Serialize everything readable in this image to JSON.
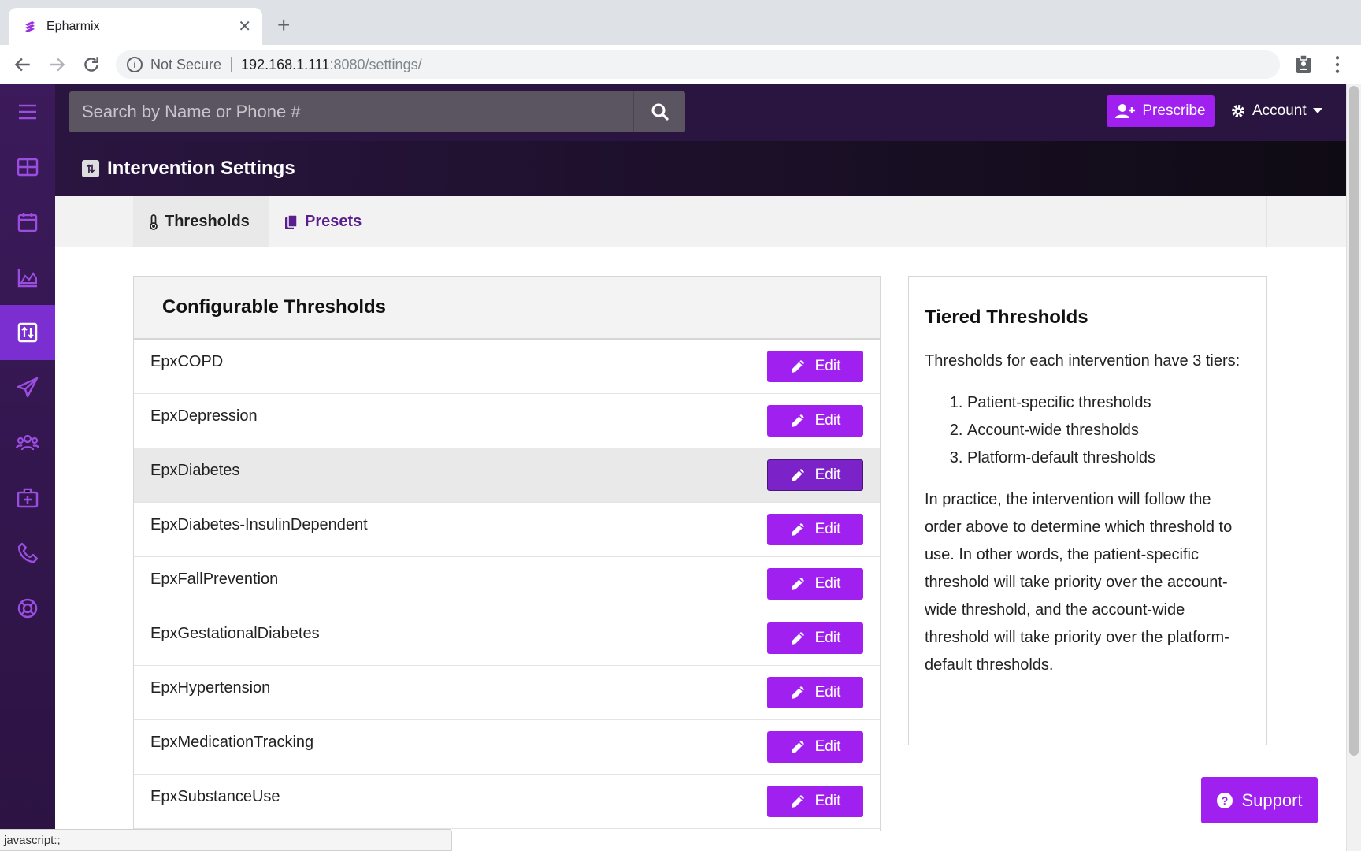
{
  "browser": {
    "tab_title": "Epharmix",
    "url_security": "Not Secure",
    "url_host": "192.168.1.111",
    "url_path": ":8080/settings/"
  },
  "topbar": {
    "search_placeholder": "Search by Name or Phone #",
    "prescribe_label": "Prescribe",
    "account_label": "Account"
  },
  "page": {
    "title": "Intervention Settings",
    "tabs": [
      {
        "label": "Thresholds",
        "active": true
      },
      {
        "label": "Presets",
        "active": false
      }
    ]
  },
  "thresholds": {
    "heading": "Configurable Thresholds",
    "edit_label": "Edit",
    "rows": [
      {
        "name": "EpxCOPD"
      },
      {
        "name": "EpxDepression"
      },
      {
        "name": "EpxDiabetes"
      },
      {
        "name": "EpxDiabetes-InsulinDependent"
      },
      {
        "name": "EpxFallPrevention"
      },
      {
        "name": "EpxGestationalDiabetes"
      },
      {
        "name": "EpxHypertension"
      },
      {
        "name": "EpxMedicationTracking"
      },
      {
        "name": "EpxSubstanceUse"
      }
    ]
  },
  "info": {
    "heading": "Tiered Thresholds",
    "intro": "Thresholds for each intervention have 3 tiers:",
    "tiers": [
      "Patient-specific thresholds",
      "Account-wide thresholds",
      "Platform-default thresholds"
    ],
    "body": "In practice, the intervention will follow the order above to determine which threshold to use. In other words, the patient-specific threshold will take priority over the account-wide threshold, and the account-wide threshold will take priority over the platform-default thresholds."
  },
  "support_label": "Support",
  "status_url": "javascript:;",
  "colors": {
    "accent": "#a020f0",
    "sidebar": "#3c1a5b",
    "topbar": "#2a1540"
  },
  "sidebar_icons": [
    "menu-icon",
    "dashboard-icon",
    "calendar-icon",
    "chart-icon",
    "settings-icon",
    "send-icon",
    "users-icon",
    "medkit-icon",
    "phone-icon",
    "lifebuoy-icon"
  ]
}
